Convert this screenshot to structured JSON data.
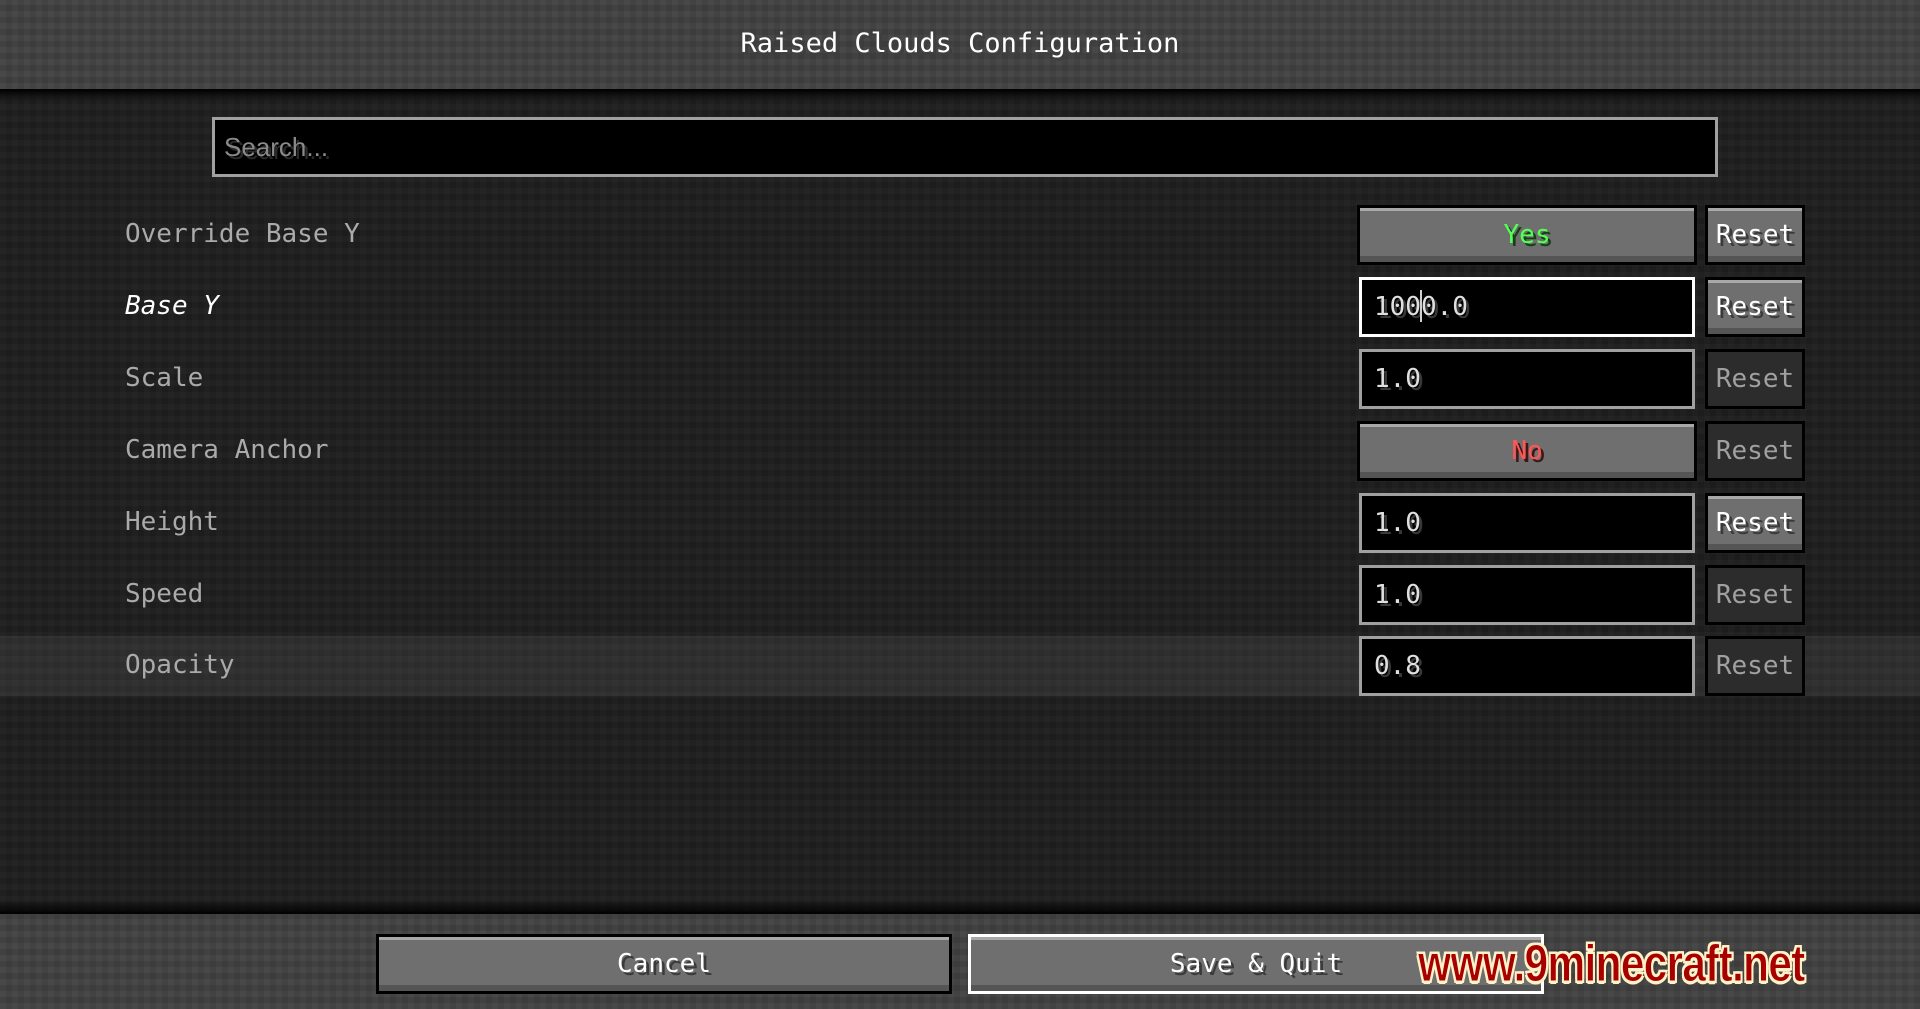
{
  "header": {
    "title": "Raised Clouds Configuration"
  },
  "search": {
    "placeholder": "Search...",
    "value": ""
  },
  "options": [
    {
      "label": "Override Base Y",
      "type": "toggle",
      "value": "Yes",
      "state": "yes",
      "modified": false,
      "reset_label": "Reset",
      "reset_enabled": true
    },
    {
      "label": "Base Y",
      "type": "number",
      "value_before_caret": "100",
      "value_after_caret": "0.0",
      "value": "1000.0",
      "focused": true,
      "modified": true,
      "reset_label": "Reset",
      "reset_enabled": true
    },
    {
      "label": "Scale",
      "type": "number",
      "value": "1.0",
      "modified": false,
      "reset_label": "Reset",
      "reset_enabled": false
    },
    {
      "label": "Camera Anchor",
      "type": "toggle",
      "value": "No",
      "state": "no",
      "modified": false,
      "reset_label": "Reset",
      "reset_enabled": false
    },
    {
      "label": "Height",
      "type": "number",
      "value": "1.0",
      "modified": false,
      "reset_label": "Reset",
      "reset_enabled": true
    },
    {
      "label": "Speed",
      "type": "number",
      "value": "1.0",
      "modified": false,
      "reset_label": "Reset",
      "reset_enabled": false
    },
    {
      "label": "Opacity",
      "type": "number",
      "value": "0.8",
      "modified": false,
      "hovered": true,
      "reset_label": "Reset",
      "reset_enabled": false
    }
  ],
  "footer": {
    "cancel_label": "Cancel",
    "save_label": "Save & Quit"
  },
  "watermark": "www.9minecraft.net",
  "colors": {
    "toggle_yes": "#55ff55",
    "toggle_no": "#ff5555",
    "modified_label": "#ffffff",
    "label": "#aaaaaa"
  }
}
